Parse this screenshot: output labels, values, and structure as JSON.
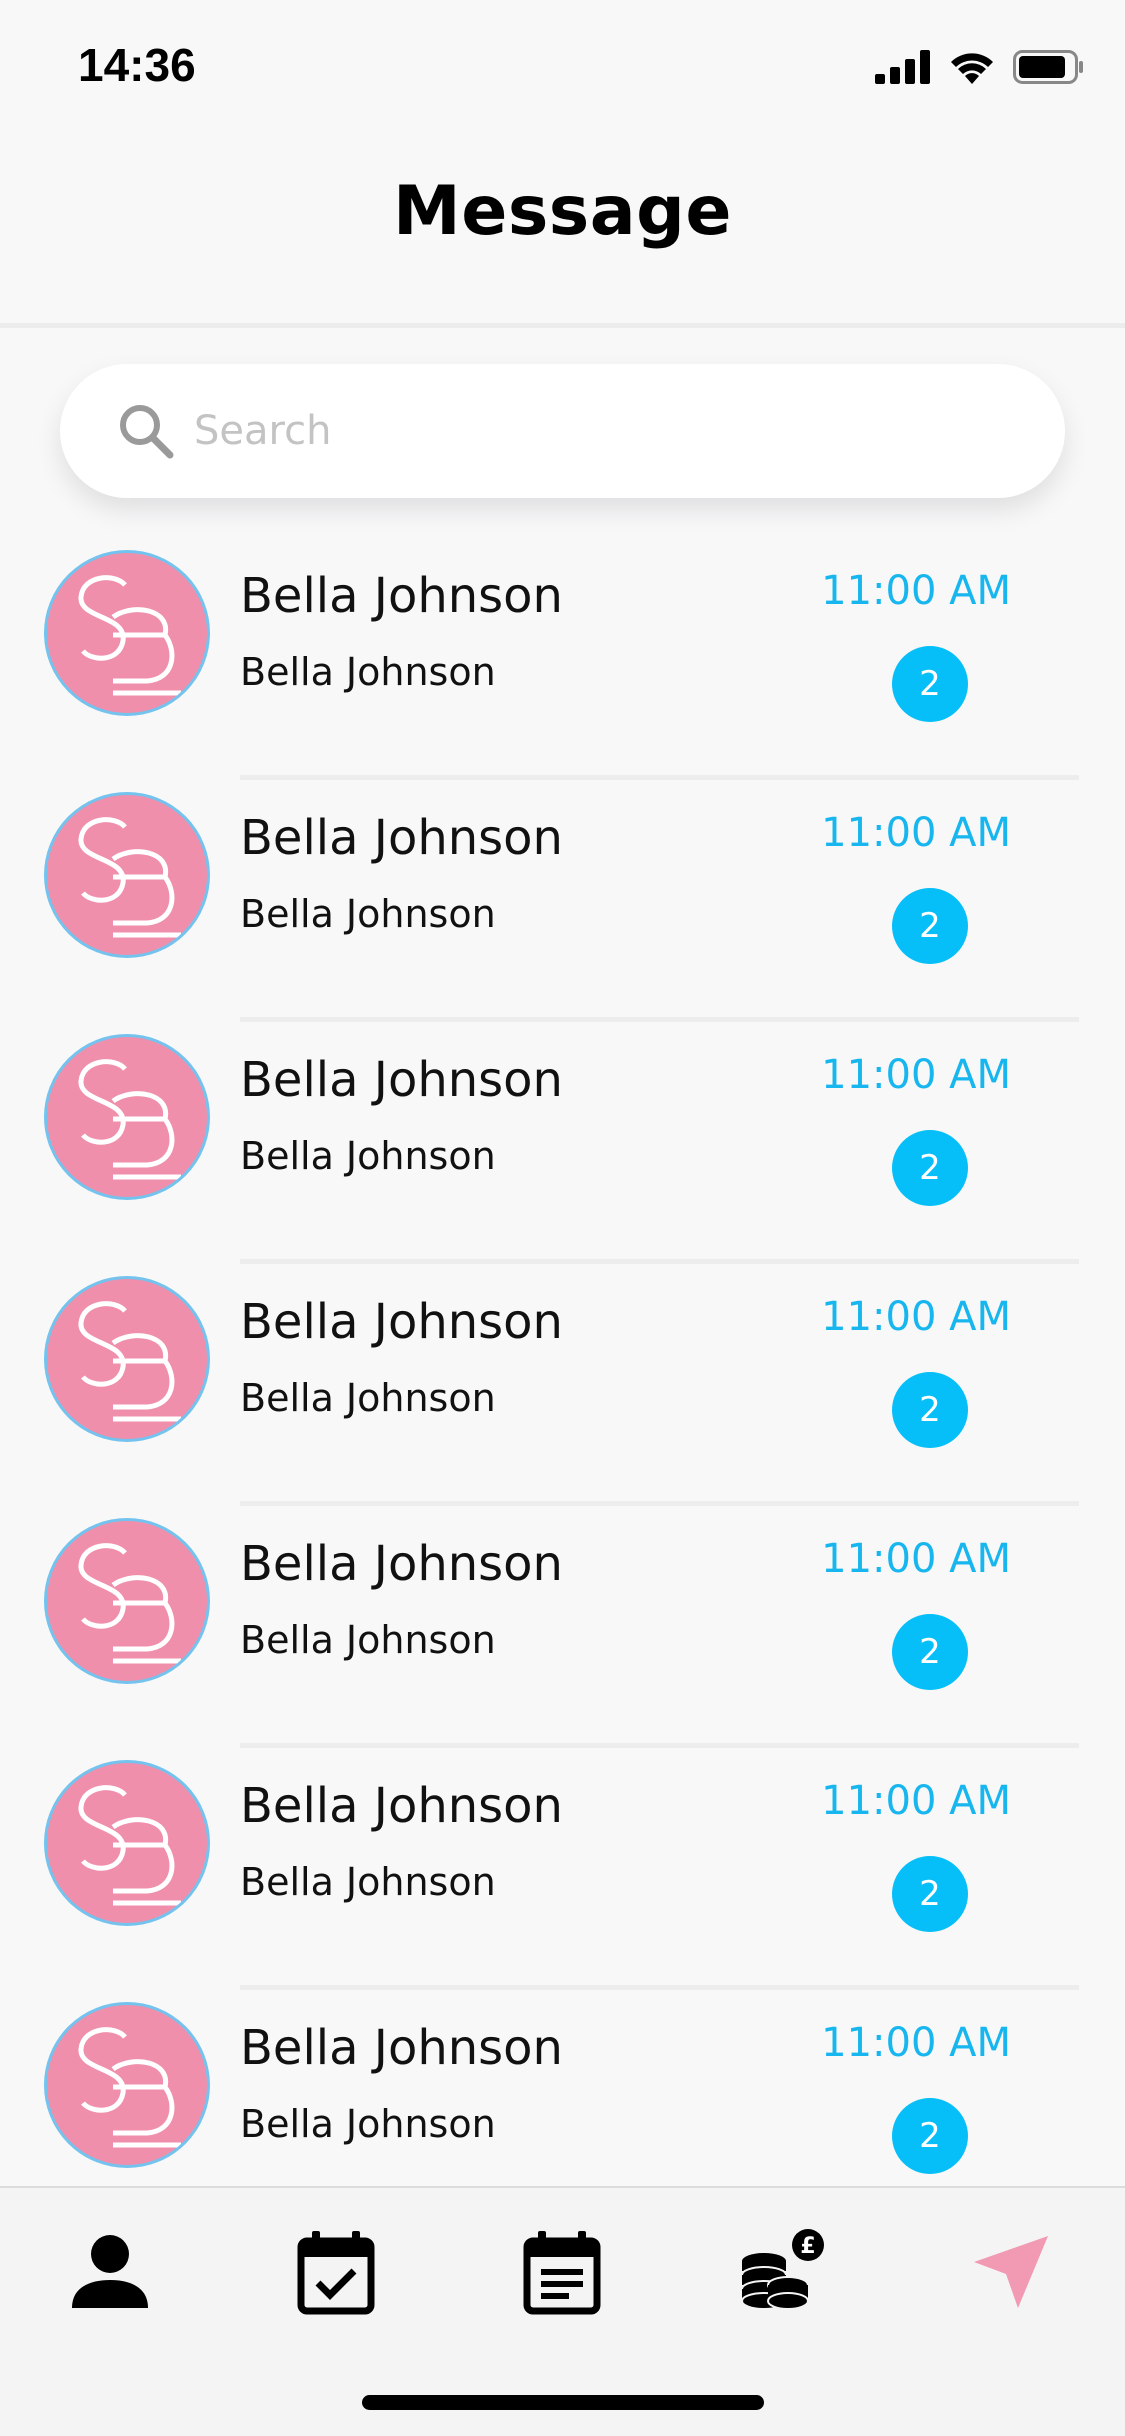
{
  "status_bar": {
    "time": "14:36"
  },
  "header": {
    "title": "Message"
  },
  "search": {
    "placeholder": "Search",
    "value": ""
  },
  "conversations": [
    {
      "name": "Bella Johnson",
      "preview": "Bella Johnson",
      "time": "11:00 AM",
      "unread": "2"
    },
    {
      "name": "Bella Johnson",
      "preview": "Bella Johnson",
      "time": "11:00 AM",
      "unread": "2"
    },
    {
      "name": "Bella Johnson",
      "preview": "Bella Johnson",
      "time": "11:00 AM",
      "unread": "2"
    },
    {
      "name": "Bella Johnson",
      "preview": "Bella Johnson",
      "time": "11:00 AM",
      "unread": "2"
    },
    {
      "name": "Bella Johnson",
      "preview": "Bella Johnson",
      "time": "11:00 AM",
      "unread": "2"
    },
    {
      "name": "Bella Johnson",
      "preview": "Bella Johnson",
      "time": "11:00 AM",
      "unread": "2"
    },
    {
      "name": "Bella Johnson",
      "preview": "Bella Johnson",
      "time": "11:00 AM",
      "unread": "2"
    }
  ],
  "tab_bar": {
    "items": [
      {
        "icon": "person-icon",
        "active": false
      },
      {
        "icon": "calendar-check-icon",
        "active": false
      },
      {
        "icon": "calendar-notes-icon",
        "active": false
      },
      {
        "icon": "coins-pound-icon",
        "active": false
      },
      {
        "icon": "send-icon",
        "active": true
      }
    ]
  },
  "colors": {
    "accent": "#17b6ee",
    "badge": "#06bff9",
    "avatar_fill": "#ef8fac",
    "avatar_ring": "#74c3ee",
    "active_tab": "#f29ab3"
  }
}
